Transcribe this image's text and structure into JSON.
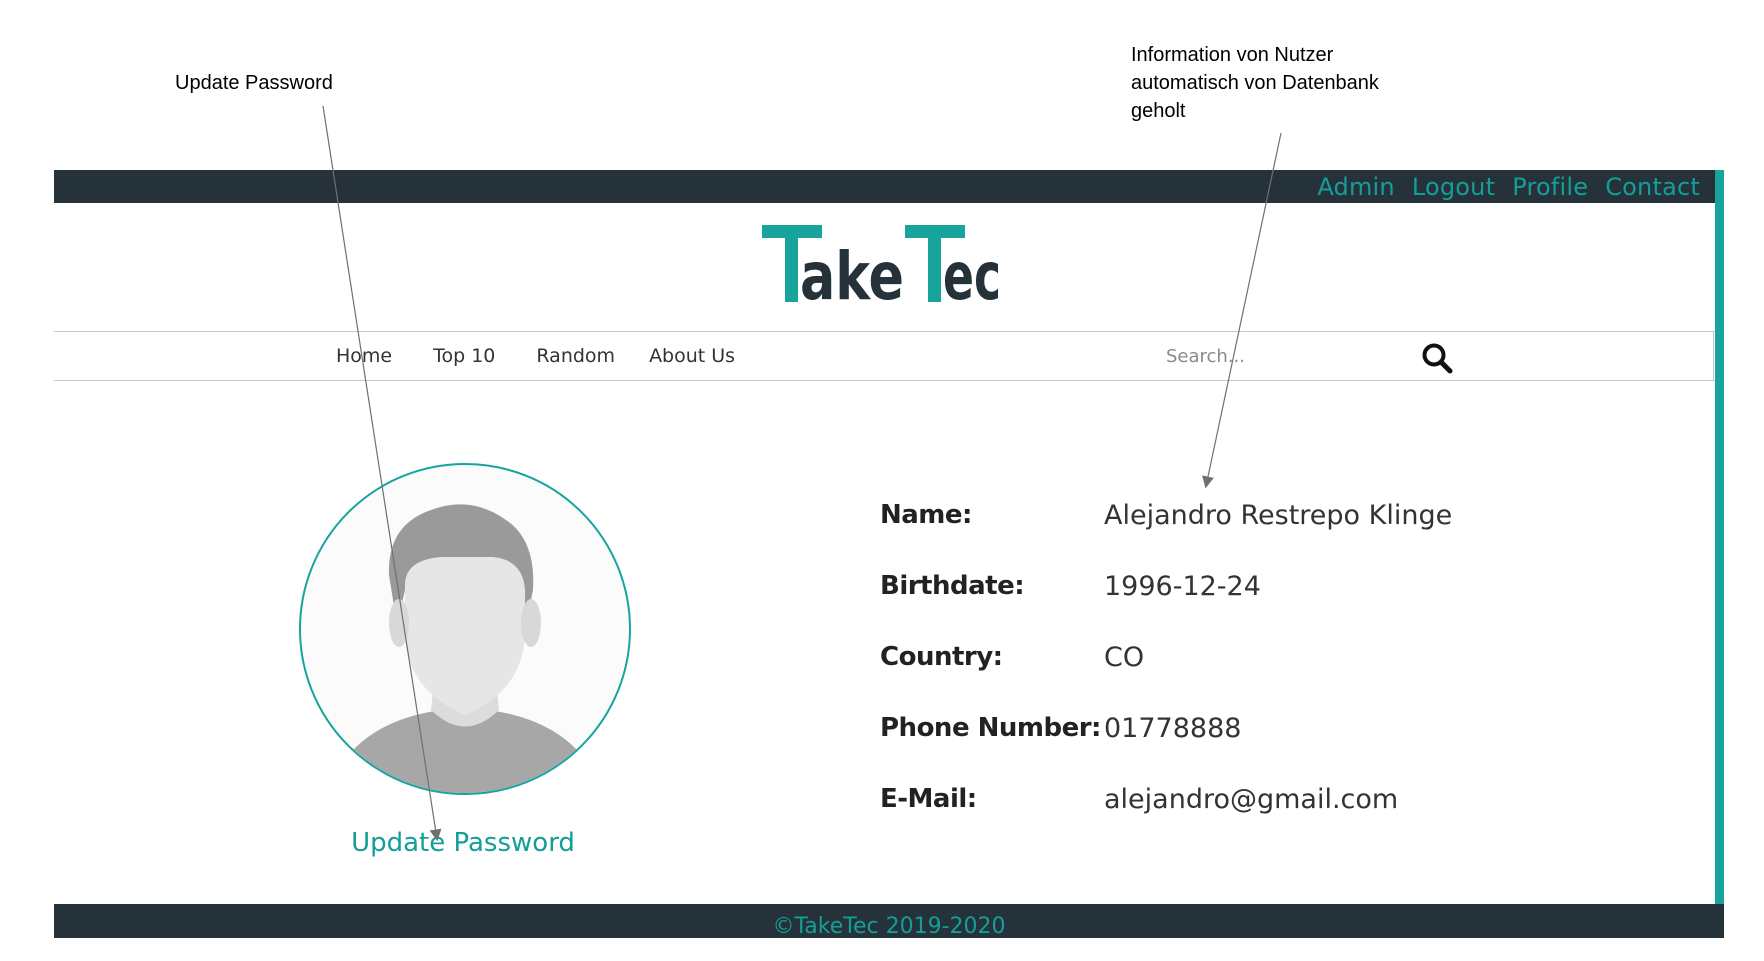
{
  "annotations": {
    "left": "Update Password",
    "right": [
      "Information von Nutzer",
      "automatisch von Datenbank",
      "geholt"
    ]
  },
  "topnav": [
    "Admin",
    "Logout",
    "Profile",
    "Contact"
  ],
  "logo": {
    "text": "TakeTec",
    "accent_color": "#17a49d",
    "dark_color": "#26323a"
  },
  "mainnav": [
    "Home",
    "Top 10",
    "Random",
    "About Us"
  ],
  "search": {
    "placeholder": "Search...",
    "icon": "search-icon"
  },
  "profile": {
    "update_password": "Update Password",
    "fields": [
      {
        "label": "Name:",
        "value": "Alejandro Restrepo Klinge"
      },
      {
        "label": "Birthdate:",
        "value": "1996-12-24"
      },
      {
        "label": "Country:",
        "value": "CO"
      },
      {
        "label": "Phone Number:",
        "value": "01778888"
      },
      {
        "label": "E-Mail:",
        "value": "alejandro@gmail.com"
      }
    ]
  },
  "footer": {
    "text": "©TakeTec 2019-2020"
  },
  "colors": {
    "accent": "#17a49d",
    "bar": "#26323a"
  }
}
